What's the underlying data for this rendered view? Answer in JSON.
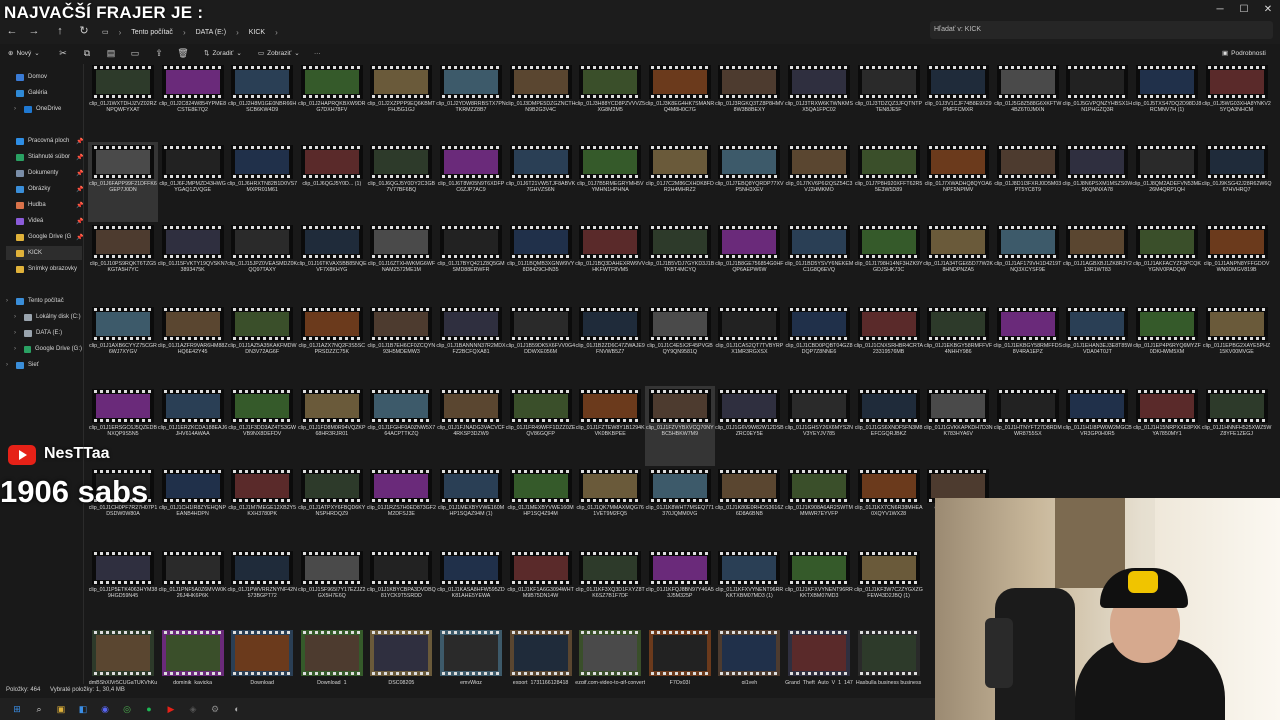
{
  "overlay": {
    "title": "NAJVAČŠÍ FRAJER JE :",
    "channel": "NesTTaa",
    "subs": "1906 sabs"
  },
  "address": {
    "crumbs": [
      "Tento počítač",
      "DATA (E:)",
      "KICK"
    ],
    "search_placeholder": "Hľadať v: KICK"
  },
  "toolbar": {
    "new": "Nový",
    "sort": "Zoradiť",
    "view": "Zobraziť",
    "details": "Podrobnosti"
  },
  "sidebar": {
    "items": [
      {
        "label": "Domov",
        "color": "#3a7bd5",
        "pin": false
      },
      {
        "label": "Galéria",
        "color": "#2f8ad6",
        "pin": false
      },
      {
        "label": "OneDrive",
        "color": "#1f78d1",
        "pin": false
      },
      {
        "label": "Pracovná ploch",
        "color": "#2e8ee5",
        "pin": true
      },
      {
        "label": "Stiahnuté súbor",
        "color": "#2aa163",
        "pin": true
      },
      {
        "label": "Dokumenty",
        "color": "#7a8ea8",
        "pin": true
      },
      {
        "label": "Obrázky",
        "color": "#3a8ed9",
        "pin": true
      },
      {
        "label": "Hudba",
        "color": "#d9724a",
        "pin": true
      },
      {
        "label": "Videá",
        "color": "#8b5bd9",
        "pin": true
      },
      {
        "label": "Google Drive (G",
        "color": "#e0b23a",
        "pin": true
      },
      {
        "label": "KICK",
        "color": "#e0b23a",
        "pin": false
      },
      {
        "label": "Snímky obrazovky",
        "color": "#e0b23a",
        "pin": false
      },
      {
        "label": "Tento počítač",
        "color": "#3a8ed9",
        "pin": false
      },
      {
        "label": "Lokálny disk (C:)",
        "color": "#9aa4ae",
        "pin": false
      },
      {
        "label": "DATA (E:)",
        "color": "#9aa4ae",
        "pin": false
      },
      {
        "label": "Google Drive (G:)",
        "color": "#2aa163",
        "pin": false
      },
      {
        "label": "Sieť",
        "color": "#3a8ed9",
        "pin": false
      }
    ]
  },
  "files": [
    [
      "clip_01J1WXTDHJZVZ02RZNPQWFYXAT",
      "clip_01J2C824W854YPME8CSTE8E7Q2",
      "clip_01J2H8M1GE0NBR66HSCB6KW4D9",
      "clip_01J2HAPRQKBXW9DRG7DXH78FV",
      "clip_01J2XZPPP9EQ6KBMTFHJ5G1GJ",
      "clip_01J2YDW8RRBSTX7PNTKRMZZ8B7",
      "clip_01J3DMPE5DZGZNCTHN9B2G3V4C",
      "clip_01J3H88YCD8PZVVVZ5XG8M2M5",
      "clip_01J3K8EG4HK7SMANRQ4M8H0C7G",
      "clip_01J3RGKQ3TZ8P8HMV8W3B8BEXY",
      "clip_01J3TRXW6KTWNKMSX5QA1FPC02",
      "clip_01J3TDZQZ3JFQTNTPTEN8JE5F",
      "clip_01J3V1CJF74B8E9X29PMFFCMXR",
      "clip_01J5G8Z588G6XKFTW4BZ6T0JMXN",
      "clip_01J5GVPQNZYHBSX1HN1PHGZQ3R",
      "clip_01J5TXS47DQ2D98DJ8RCMNV7H (1)",
      "clip_01J5WG03XHA8YNKV25YQA3NHCM"
    ],
    [
      "clip_01J6FAPP99F21DFFK6GEP7J0DN",
      "clip_01J6FJMPMZD43HWGYGAQ1ZVQGE",
      "clip_01J6HRXTN82B1D0VS7MXPR01M61",
      "clip_01J6QGJ5Y0D... (1)",
      "clip_01J6QGJ5Y0DY2C3GB7V77BF6BQ",
      "clip_01J6T8W05N9T6XDFPC6ZJP7AC9",
      "clip_01J6T21VW5TJF8ABVK7GHVZS6N",
      "clip_01J7B5RMEGRYMH5VYMHN1HPHNA",
      "clip_01J7C2M86CXHDK8FDR2H4MHRZ2",
      "clip_01J7EBQ8YQRDP77XVP5NH3XEV",
      "clip_01J7KV6P6I2QSZ54C3VJ2HMKMO",
      "clip_01J7P8H920XFFT62R55E3W5D89",
      "clip_01J7XWADHQ8QYOA6NPF5NPIMV",
      "clip_01J8D1I3FXRJ0D5M03PT5YC8T9",
      "clip_01J8N6PSXM1MSZS0W5KQNNXA78",
      "clip_01J8QM2ADEFVN53ME26M4QRP1QH",
      "clip_01J9KSG42J28R62W6Q67HVHRQ7"
    ],
    [
      "clip_01J10PS9RQKT6TZG5KGTA5H7YC",
      "clip_01J15FVKTY19QVSKN73893475K",
      "clip_01J15JPZ0VEASMDZ0KQQ97TAXY",
      "clip_01J16TKVAX5BB85NQEVF7X8KHYG",
      "clip_01J16ZTXHWKMG6WFNAMZ572ME1M",
      "clip_01J17BYQ421Z8Q5GMSMD88ERWFR",
      "clip_01J1BQMB3XGNW9VY8D8429CHN35",
      "clip_01J1BQ3DAHEXRW9VVHKFWTF8VM5",
      "clip_01J1B5VDJ7GYKD3J1BTKBT4MCYQ",
      "clip_01J1B8GE756854G0HFQP6AEPW6W",
      "clip_01J1BD5YSVY6NEKEMC1G8Q6EVQ",
      "clip_01J1798H14NF3HZK9YGDJSHK73C",
      "clip_01J1A34TGE65D77W2K8HNDPNZA5",
      "clip_01J1AF179VH1D4219TNQ3XCYSF9E",
      "clip_01J1AGBXBJ1ZK8RJY213R1WT83",
      "clip_01J1AKFACYZF3PCQKYGNV0PADQW",
      "clip_01J1ANPN8YFFGDOVWN0DMGV819B"
    ],
    [
      "clip_01J1AXB6CYYZ75CGR6WJ7XYGV",
      "clip_01J1AZFR9VAR6HM88ZHQ6E42Y45",
      "clip_01J1AZ5A35KAKFMDWDN3V72AG6F",
      "clip_01J1AZX7NQ2F3S5SCPRSDZZC75K",
      "clip_01J1B7EH6CF0ZCQYN93H5MDEMW3",
      "clip_01J1BANNNN37R2MDXFZ2BCFQXA81",
      "clip_01J1B59DK5X6FVV0G4DDWXE056M",
      "clip_01J1B2ZD6C47ZWAJE9FNVWB5Z7",
      "clip_01J1C4E5X2F45PVGBQY9QN9581Q",
      "clip_01J1CAS2QT7TVBYRPX1MR3RGXSX",
      "clip_01J1CBD0PQBT04GZ8DQP7Z8NNE6",
      "clip_01J1CNXSRHBR4CRTA23319576MB",
      "clip_01J1EKBGY58RMFFVF4NHHY986",
      "clip_01J1EKBGY58RMFFDS8V4RA1EPZ",
      "clip_01J1EHAN3EJ3E8T85WVDA04T0JT",
      "clip_01J1EP4P6RYQ6MYZF0DKHWM5XM",
      "clip_01J1EPBG2XAYE5PHZ15KV00MVGE"
    ],
    [
      "clip_01J1ERSGC6J5QZEDBNXQP9S5N5",
      "clip_01J1ERZKCDA188EAJ6JHV614AWAA",
      "clip_01J1F3DD3AZ4TS3GWVB9NX8DEFDV",
      "clip_01J1FD8M0R94VQZKP68HR3RJR01",
      "clip_01J1FGHF0A0ZNW5X764ACPTTKZQ",
      "clip_01J1FJNADG3VACVCF4RKSP3DZW9",
      "clip_01J1FR49WFF1DZZ0ZEQV86GQFP",
      "clip_01J1FZTEW8Y1B1294KVK0BKBPEE",
      "clip_01J1FZVYBXVCQ70NYBC5HBKW7M9",
      "clip_01J1G6V9W82W12DSBZRC0EY5E",
      "clip_01J1GHSY26X6MYS2NV3YEYJV785",
      "clip_01J1GS6XNDF5FN3M8EFCGQRJBKZ",
      "clip_01J1GVKKAPKDH7D3NK783HYA6V",
      "clip_01J1HTNYFT27D8RDMWR8755SX",
      "clip_01J1H1I8PW0W2MGCBVR3GP0H0R5",
      "clip_01J1H15NRPXXE8PXKYA7850MY1",
      "clip_01J1HNNFH525XWZ5WZ8YFE1ZEGJ"
    ],
    [
      "clip_01J1CH0PF7R27H07P1DSDW0W80A",
      "clip_01J1CH1IR8ZYEHQNPEANB4HDPN",
      "clip_01J1M7MEGE12XB2Y5KXH3780PK",
      "clip_01J1ATPXY6FBQD6KYNSPHRDQZ9",
      "clip_01J1RZS7H0ED873GF2M2DFSJ3E",
      "clip_01J1MEXBYVWE160MHP1SQAZ94M (1)",
      "clip_01J1MEXBYVWE160MHP1SQ4Z94M",
      "clip_01J1QK7MMAXMQG761VET9M2FQ5",
      "clip_01J1K8WHT7MSEQ771370JQMM0VG",
      "clip_01J1K80E0RHDS3616Z6D8A6BNB",
      "clip_01J1K908A6AR2SWTMMMWR7EYVFP",
      "clip_01J1KX7CN6R38MHEA0XQYV1WX28",
      "clip_01J1KA0VTR..."
    ],
    [
      "clip_01J1P5ETK4063HYM389HGD59N45",
      "clip_01J1PNF5A0Z6MVW0K26J4HK6P6K",
      "clip_01J1PWVRRZNYNF42N573BGPT72",
      "clip_01J1SF965I7Y17EZJZ2GX5H7E6Q",
      "clip_01J1KBYCBPA3DVDBQ81YCK9T5SRDD",
      "clip_01J1KASA8HFW595ZDK81AHE5YEWA",
      "clip_01J1KF1A6G3094WHTM9B75DN14W",
      "clip_01J1KF3XQ3D1FXYZ8TK6SZ7B1F7DF",
      "clip_01J1KFQJ8BN97Y46A53J5M325P",
      "clip_01J1KFXVYNENT96RRKKTXBM07MD3 (1)",
      "clip_01J1KFXVYNENT96RRKKTXBM07MD3",
      "clip_01J1KF3W7C2ZYGXZGFEW43D2JBQ (1)"
    ],
    [
      "dmBShXlVr5CUGaTUKVhKuW-1200-80",
      "dominik_kavicka",
      "Download",
      "Download_1",
      "DSC08205",
      "emyWigz",
      "export_1731166128418",
      "ezgif.com-video-to-gif-converter",
      "F7Ox03I",
      "gj1yeh",
      "Grand_Theft_Auto_V_1_147443469450490496",
      "Hasbulla business business"
    ]
  ],
  "status": {
    "count": "Položky: 464",
    "selected": "Vybraté položky: 1, 30,4 MB"
  },
  "taskbar_icons": [
    "windows-icon",
    "search-icon",
    "file-explorer-icon",
    "store-icon",
    "discord-icon",
    "chrome-icon",
    "spotify-icon",
    "media-icon",
    "obs-icon",
    "settings-icon",
    "app-icon"
  ]
}
